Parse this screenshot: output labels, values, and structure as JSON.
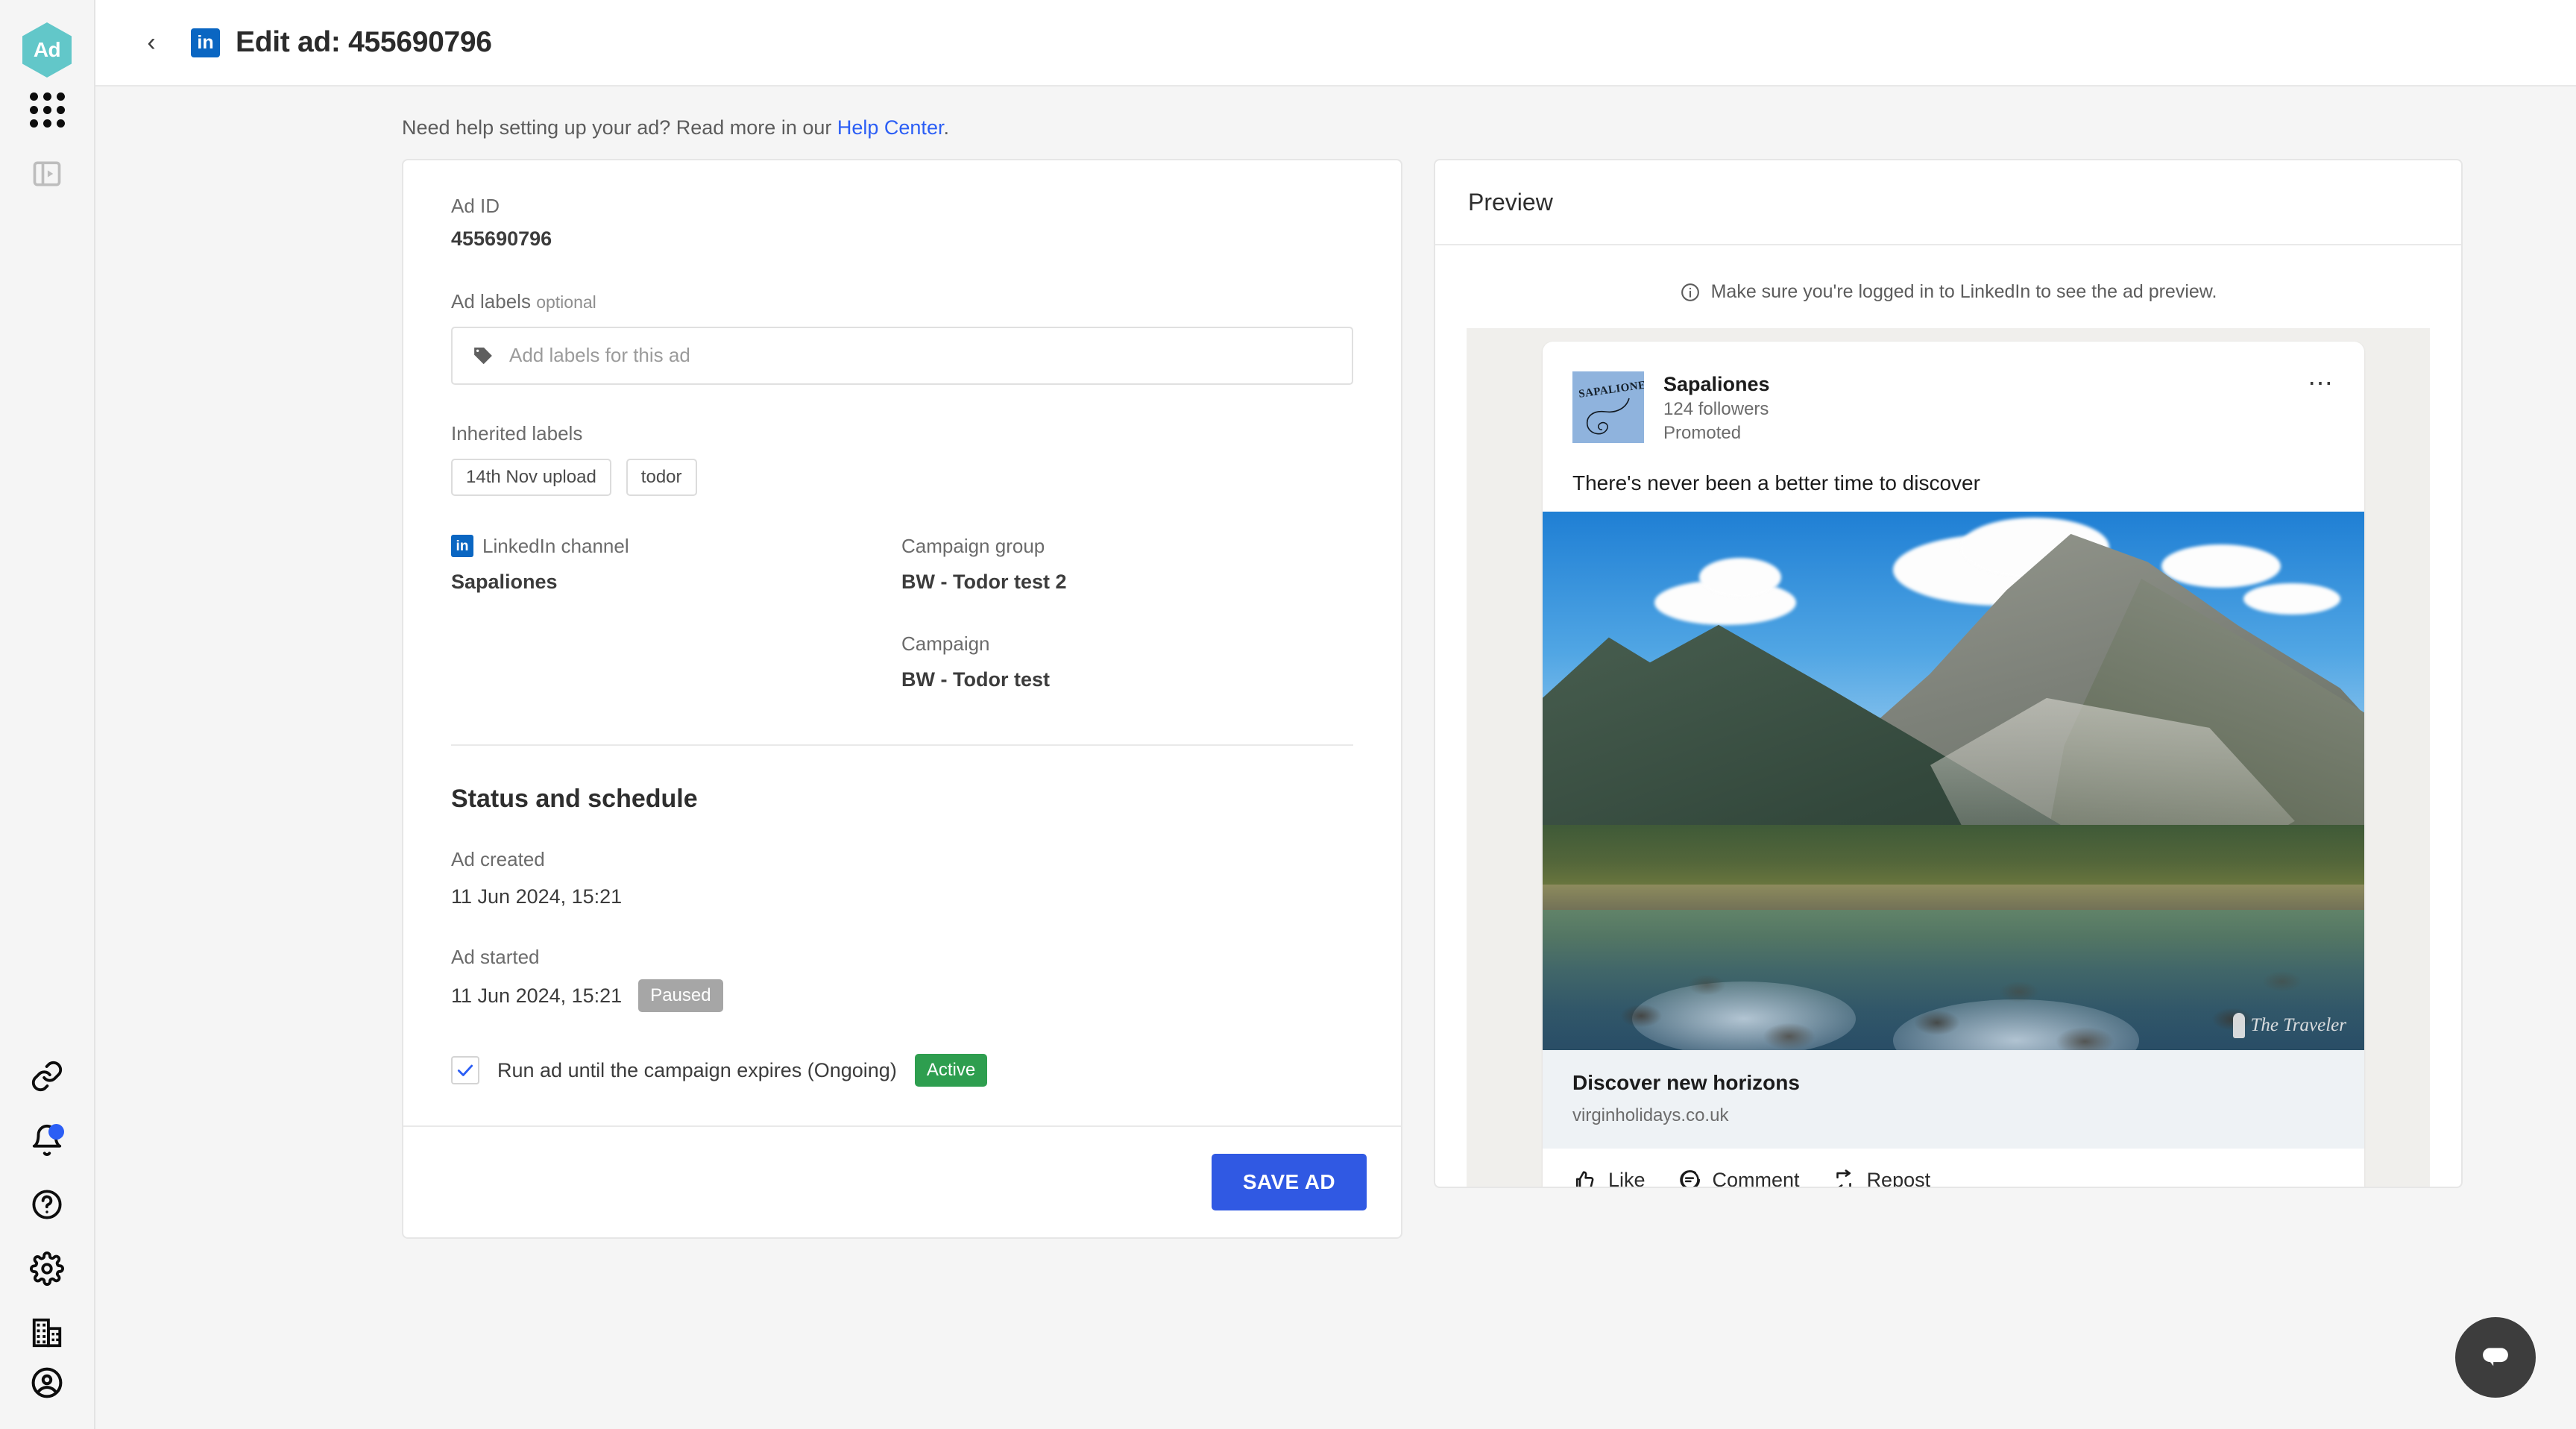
{
  "brand": {
    "logo_text": "Ad"
  },
  "sidebar": {
    "items": [
      {
        "name": "apps-grid-icon",
        "label": "Apps"
      },
      {
        "name": "panel-toggle-icon",
        "label": "Toggle panel"
      },
      {
        "name": "link-icon",
        "label": "Links"
      },
      {
        "name": "bell-icon",
        "label": "Notifications"
      },
      {
        "name": "help-circle-icon",
        "label": "Help"
      },
      {
        "name": "gear-icon",
        "label": "Settings"
      },
      {
        "name": "building-icon",
        "label": "Organisation"
      },
      {
        "name": "account-circle-icon",
        "label": "Account"
      }
    ]
  },
  "topbar": {
    "back_label": "‹",
    "channel_badge": "in",
    "title": "Edit ad: 455690796"
  },
  "help": {
    "text": "Need help setting up your ad? Read more in our ",
    "link_label": "Help Center",
    "period": "."
  },
  "form": {
    "ad_id": {
      "label": "Ad ID",
      "value": "455690796"
    },
    "ad_labels": {
      "label": "Ad labels",
      "optional": "optional",
      "placeholder": "Add labels for this ad",
      "icon": "tag-icon"
    },
    "inherited_labels": {
      "label": "Inherited labels",
      "chips": [
        "14th Nov upload",
        "todor"
      ]
    },
    "channel": {
      "label": "LinkedIn channel",
      "value": "Sapaliones",
      "icon": "linkedin-icon"
    },
    "campaign_group": {
      "label": "Campaign group",
      "value": "BW - Todor test 2"
    },
    "campaign": {
      "label": "Campaign",
      "value": "BW - Todor test"
    },
    "status_section_title": "Status and schedule",
    "ad_created": {
      "label": "Ad created",
      "value": "11 Jun 2024, 15:21"
    },
    "ad_started": {
      "label": "Ad started",
      "value": "11 Jun 2024, 15:21",
      "badge": "Paused"
    },
    "ongoing": {
      "label": "Run ad until the campaign expires (Ongoing)",
      "badge": "Active",
      "checked": true
    },
    "save_label": "SAVE AD"
  },
  "preview": {
    "title": "Preview",
    "note": "Make sure you're logged in to LinkedIn to see the ad preview.",
    "note_icon": "info-icon",
    "post": {
      "avatar_text": "SAPALIONES",
      "author": "Sapaliones",
      "followers": "124 followers",
      "promoted": "Promoted",
      "menu_icon": "more-horizontal-icon",
      "body": "There's never been a better time to discover",
      "image_watermark": "The Traveler",
      "cta_title": "Discover new horizons",
      "cta_url": "virginholidays.co.uk",
      "actions": [
        {
          "label": "Like",
          "icon": "thumbs-up-icon"
        },
        {
          "label": "Comment",
          "icon": "comment-icon"
        },
        {
          "label": "Repost",
          "icon": "repost-icon"
        }
      ]
    }
  },
  "chat": {
    "icon": "chat-bubble-icon"
  },
  "colors": {
    "accent_blue": "#3059e3",
    "link_blue": "#2b5ef5",
    "linkedin_blue": "#0a66c2",
    "badge_active_green": "#2e9e4f",
    "badge_paused_grey": "#a6a6a6",
    "logo_teal": "#62c7c9"
  }
}
